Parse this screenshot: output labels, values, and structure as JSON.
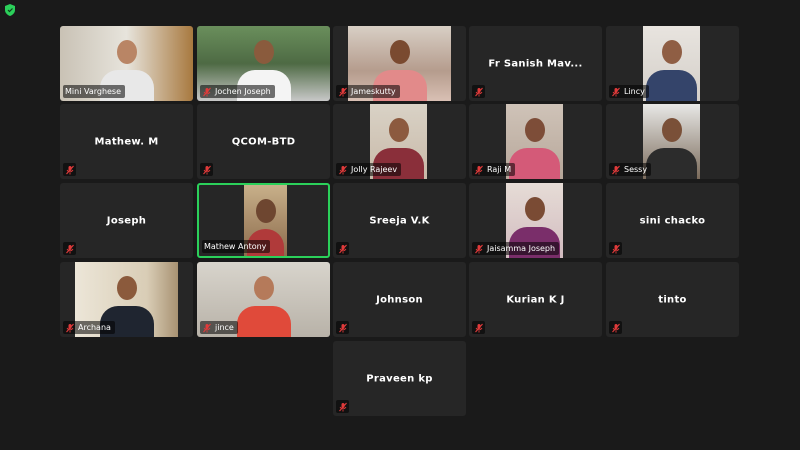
{
  "app": {
    "security_icon": "shield-icon",
    "accent": "#2bd05a"
  },
  "participants": [
    {
      "name": "Mini Varghese",
      "video": true,
      "muted": false
    },
    {
      "name": "Jochen Joseph",
      "video": true,
      "muted": true
    },
    {
      "name": "Jameskutty",
      "video": true,
      "muted": true
    },
    {
      "name": "Fr Sanish Mav...",
      "video": false,
      "muted": true
    },
    {
      "name": "Lincy",
      "video": true,
      "muted": true
    },
    {
      "name": "Mathew. M",
      "video": false,
      "muted": true
    },
    {
      "name": "QCOM-BTD",
      "video": false,
      "muted": true
    },
    {
      "name": "Jolly Rajeev",
      "video": true,
      "muted": true
    },
    {
      "name": "Raji M",
      "video": true,
      "muted": true
    },
    {
      "name": "Sessy",
      "video": true,
      "muted": true
    },
    {
      "name": "Joseph",
      "video": false,
      "muted": true
    },
    {
      "name": "Mathew Antony",
      "video": true,
      "muted": false,
      "active_speaker": true
    },
    {
      "name": "Sreeja V.K",
      "video": false,
      "muted": true
    },
    {
      "name": "Jaisamma Joseph",
      "video": true,
      "muted": true
    },
    {
      "name": "sini chacko",
      "video": false,
      "muted": true
    },
    {
      "name": "Archana",
      "video": true,
      "muted": true
    },
    {
      "name": "jince",
      "video": true,
      "muted": true
    },
    {
      "name": "Johnson",
      "video": false,
      "muted": true
    },
    {
      "name": "Kurian K J",
      "video": false,
      "muted": true
    },
    {
      "name": "tinto",
      "video": false,
      "muted": true
    },
    {
      "name": "Praveen kp",
      "video": false,
      "muted": true
    }
  ]
}
